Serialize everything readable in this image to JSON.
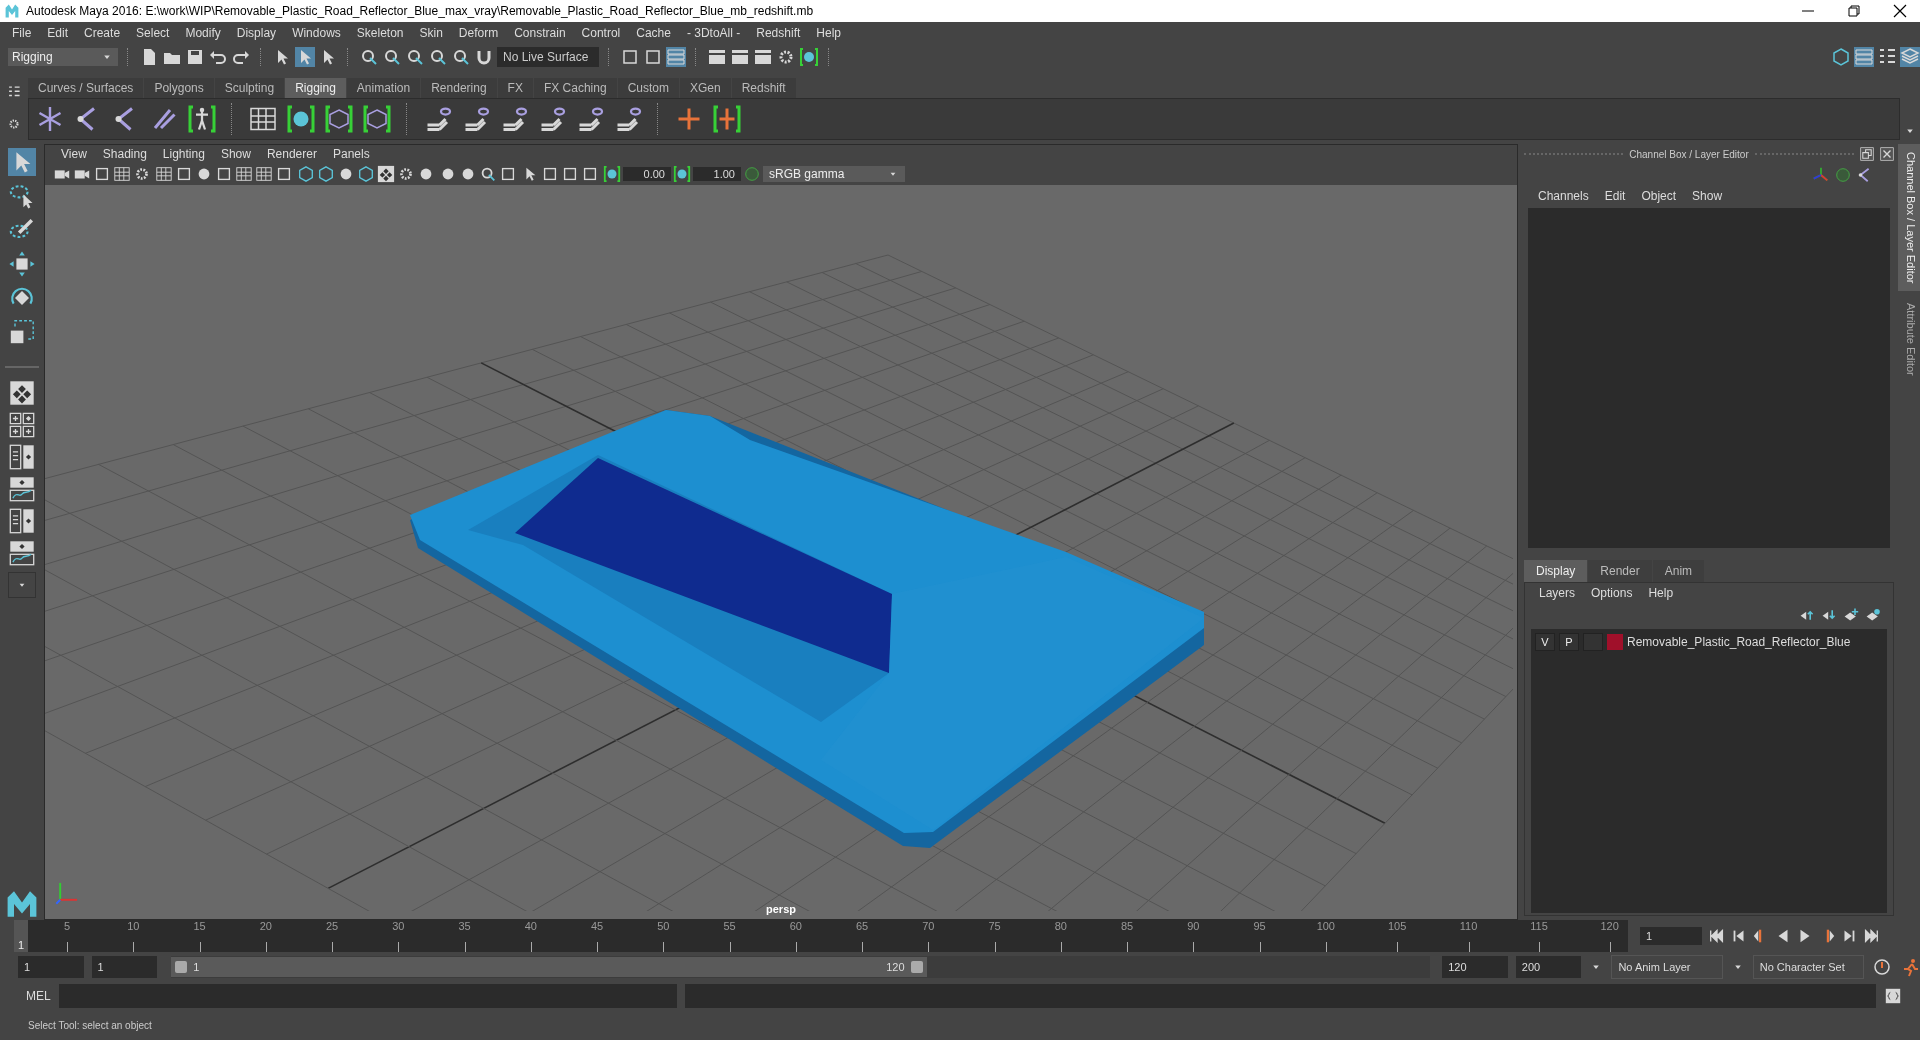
{
  "window": {
    "title": "Autodesk Maya 2016: E:\\work\\WIP\\Removable_Plastic_Road_Reflector_Blue_max_vray\\Removable_Plastic_Road_Reflector_Blue_mb_redshift.mb"
  },
  "menu_bar": [
    "File",
    "Edit",
    "Create",
    "Select",
    "Modify",
    "Display",
    "Windows",
    "Skeleton",
    "Skin",
    "Deform",
    "Constrain",
    "Control",
    "Cache",
    "- 3DtoAll -",
    "Redshift",
    "Help"
  ],
  "status_line": {
    "menu_set": "Rigging",
    "live_surface": "No Live Surface"
  },
  "shelf": {
    "tabs": [
      {
        "label": "Curves / Surfaces",
        "selected": false
      },
      {
        "label": "Polygons",
        "selected": false
      },
      {
        "label": "Sculpting",
        "selected": false
      },
      {
        "label": "Rigging",
        "selected": true
      },
      {
        "label": "Animation",
        "selected": false
      },
      {
        "label": "Rendering",
        "selected": false
      },
      {
        "label": "FX",
        "selected": false
      },
      {
        "label": "FX Caching",
        "selected": false
      },
      {
        "label": "Custom",
        "selected": false
      },
      {
        "label": "XGen",
        "selected": false
      },
      {
        "label": "Redshift",
        "selected": false
      }
    ]
  },
  "viewport": {
    "menu": [
      "View",
      "Shading",
      "Lighting",
      "Show",
      "Renderer",
      "Panels"
    ],
    "near_value": "0.00",
    "far_value": "1.00",
    "color_space": "sRGB gamma",
    "camera": "persp"
  },
  "channel_box": {
    "title": "Channel Box / Layer Editor",
    "menu": [
      "Channels",
      "Edit",
      "Object",
      "Show"
    ]
  },
  "layer_editor": {
    "tabs": [
      {
        "label": "Display",
        "selected": true
      },
      {
        "label": "Render",
        "selected": false
      },
      {
        "label": "Anim",
        "selected": false
      }
    ],
    "menu": [
      "Layers",
      "Options",
      "Help"
    ],
    "layers": [
      {
        "visible": "V",
        "playback": "P",
        "name": "Removable_Plastic_Road_Reflector_Blue",
        "color": "#a0102a"
      }
    ]
  },
  "side_tabs": [
    {
      "label": "Channel Box / Layer Editor",
      "selected": true
    },
    {
      "label": "Attribute Editor",
      "selected": false
    }
  ],
  "time_slider": {
    "ticks": [
      "5",
      "10",
      "15",
      "20",
      "25",
      "30",
      "35",
      "40",
      "45",
      "50",
      "55",
      "60",
      "65",
      "70",
      "75",
      "80",
      "85",
      "90",
      "95",
      "100",
      "105",
      "110",
      "115",
      "120"
    ],
    "current_frame": "1",
    "level": 0,
    "frame_field": "1"
  },
  "range_slider": {
    "start_field": "1",
    "current_field": "1",
    "range_start": "1",
    "range_end": "120",
    "level": 0.6,
    "end_field": "120",
    "max_field": "200",
    "anim_layer": "No Anim Layer",
    "character_set": "No Character Set"
  },
  "command_line": {
    "label": "MEL"
  },
  "help_line": "Select Tool: select an object"
}
